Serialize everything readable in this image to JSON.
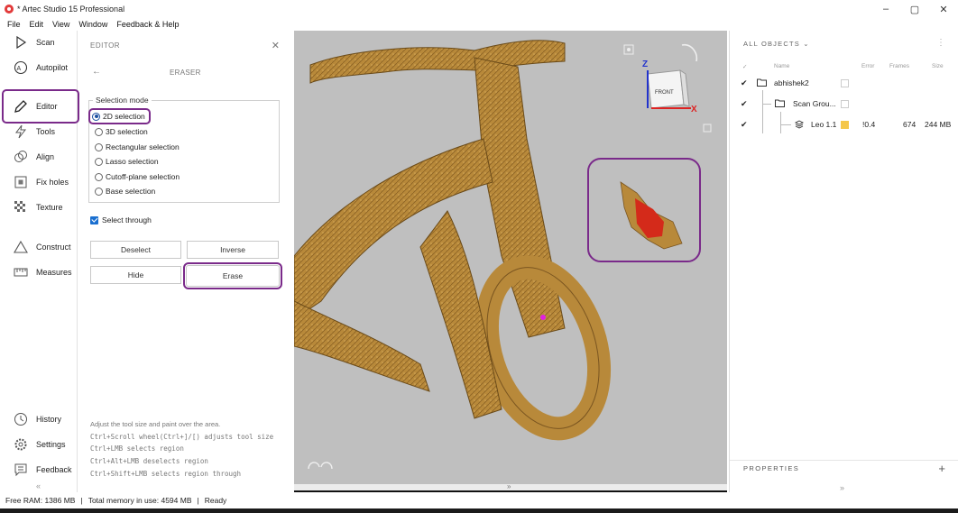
{
  "window": {
    "title": "* Artec Studio 15 Professional",
    "controls": [
      "–",
      "▢",
      "✕"
    ]
  },
  "menu": [
    "File",
    "Edit",
    "View",
    "Window",
    "Feedback & Help"
  ],
  "nav": {
    "items": [
      {
        "label": "Scan",
        "icon": "scan-icon"
      },
      {
        "label": "Autopilot",
        "icon": "autopilot-icon"
      },
      {
        "label": "Editor",
        "icon": "pencil-icon"
      },
      {
        "label": "Tools",
        "icon": "tools-icon"
      },
      {
        "label": "Align",
        "icon": "align-icon"
      },
      {
        "label": "Fix holes",
        "icon": "fix-holes-icon"
      },
      {
        "label": "Texture",
        "icon": "texture-icon"
      },
      {
        "label": "Construct",
        "icon": "construct-icon"
      },
      {
        "label": "Measures",
        "icon": "measures-icon"
      },
      {
        "label": "History",
        "icon": "history-icon"
      },
      {
        "label": "Settings",
        "icon": "gear-icon"
      },
      {
        "label": "Feedback",
        "icon": "feedback-icon"
      }
    ],
    "collapse": "«"
  },
  "editor": {
    "header": "EDITOR",
    "close": "✕",
    "back": "←",
    "tool": "ERASER",
    "selection_mode_label": "Selection mode",
    "modes": [
      "2D selection",
      "3D selection",
      "Rectangular selection",
      "Lasso selection",
      "Cutoff-plane selection",
      "Base selection"
    ],
    "selected_mode": "2D selection",
    "select_through": "Select through",
    "buttons": {
      "deselect": "Deselect",
      "inverse": "Inverse",
      "hide": "Hide",
      "erase": "Erase"
    },
    "hints": [
      "Adjust the tool size and paint over the area.",
      "Ctrl+Scroll wheel(Ctrl+]/[) adjusts tool size",
      "Ctrl+LMB selects region",
      "Ctrl+Alt+LMB deselects region",
      "Ctrl+Shift+LMB selects region through"
    ]
  },
  "viewport": {
    "cube_front": "FRONT",
    "axis_z": "Z",
    "axis_x": "X",
    "expand": "»",
    "model_color": "#b8893a",
    "selection_color": "#d42a1a"
  },
  "objects": {
    "header": "ALL OBJECTS",
    "columns": {
      "name": "Name",
      "error": "Error",
      "frames": "Frames",
      "size": "Size"
    },
    "rows": [
      {
        "name": "abhishek2",
        "error": "",
        "frames": "",
        "size": ""
      },
      {
        "name": "Scan Grou...",
        "error": "",
        "frames": "",
        "size": ""
      },
      {
        "name": "Leo 1.1",
        "error": "!0.4",
        "frames": "674",
        "size": "244 MB"
      }
    ],
    "properties": "PROPERTIES",
    "expand": "»"
  },
  "status": {
    "free_ram": "Free RAM: 1386 MB",
    "total_memory": "Total memory in use: 4594 MB",
    "state": "Ready"
  }
}
